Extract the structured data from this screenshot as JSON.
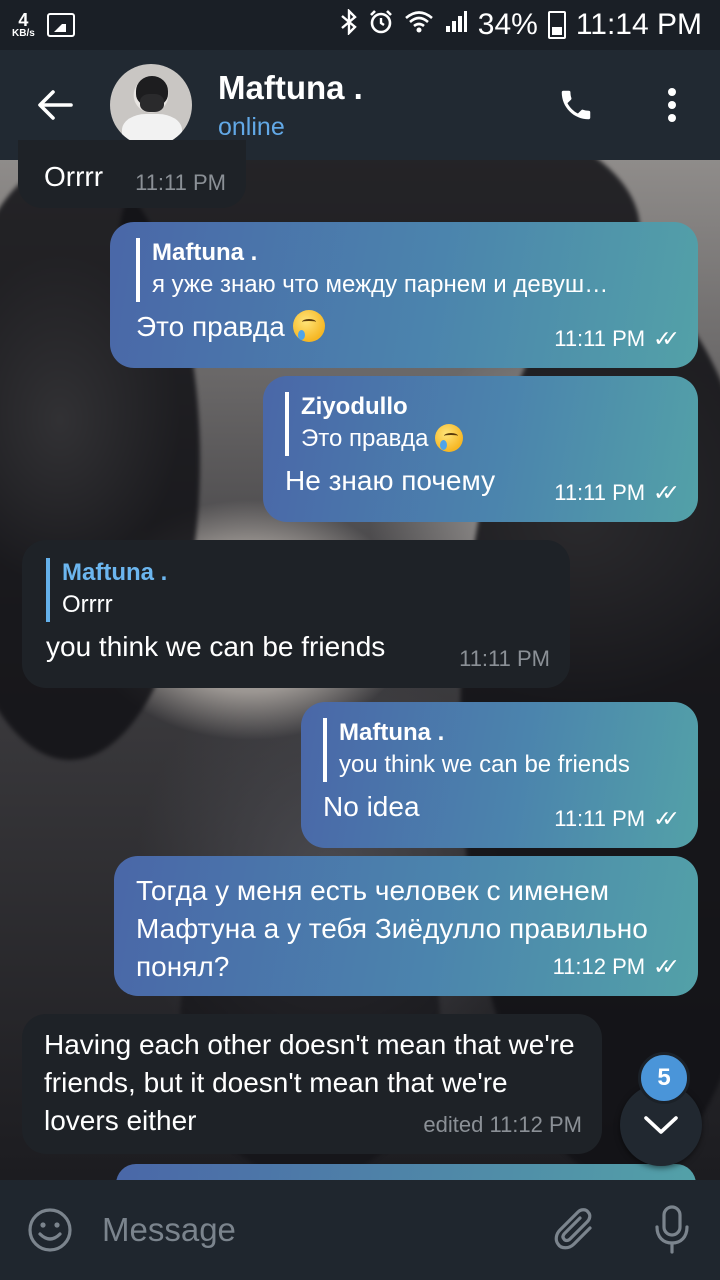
{
  "status_bar": {
    "net_speed_value": "4",
    "net_speed_unit": "KB/s",
    "battery": "34%",
    "time": "11:14 PM",
    "icons": [
      "gallery-icon",
      "bluetooth-icon",
      "alarm-icon",
      "wifi-icon",
      "signal-icon",
      "battery-icon"
    ]
  },
  "header": {
    "contact_name": "Maftuna .",
    "status": "online"
  },
  "messages": [
    {
      "direction": "in",
      "text": "Orrrr",
      "time": "11:11 PM"
    },
    {
      "direction": "out",
      "reply_name": "Maftuna .",
      "reply_text": "я уже знаю что между парнем и девуш…",
      "text": "Это правда",
      "emoji": "crying-face",
      "time": "11:11 PM"
    },
    {
      "direction": "out",
      "reply_name": "Ziyodullo",
      "reply_text": "Это правда",
      "reply_emoji": "crying-face",
      "text": "Не знаю почему",
      "time": "11:11 PM"
    },
    {
      "direction": "in",
      "reply_name": "Maftuna .",
      "reply_text": "Orrrr",
      "text": "you think we can be friends",
      "time": "11:11 PM"
    },
    {
      "direction": "out",
      "reply_name": "Maftuna .",
      "reply_text": "you think we can be friends",
      "text": "No idea",
      "time": "11:11 PM"
    },
    {
      "direction": "out",
      "text": "Тогда у меня есть человек с именем Мафтуна а у тебя Зиёдулло правильно понял?",
      "time": "11:12 PM"
    },
    {
      "direction": "in",
      "text": "Having each other doesn't mean that we're friends, but it doesn't mean that we're lovers either",
      "time": "edited 11:12 PM"
    }
  ],
  "unread_badge": "5",
  "input": {
    "placeholder": "Message"
  },
  "colors": {
    "header_bg": "#212932",
    "accent": "#62a8e6",
    "incoming_bubble": "#1e2227",
    "outgoing_bubble_start": "#4a67a8",
    "outgoing_bubble_end": "#53a1a8"
  }
}
